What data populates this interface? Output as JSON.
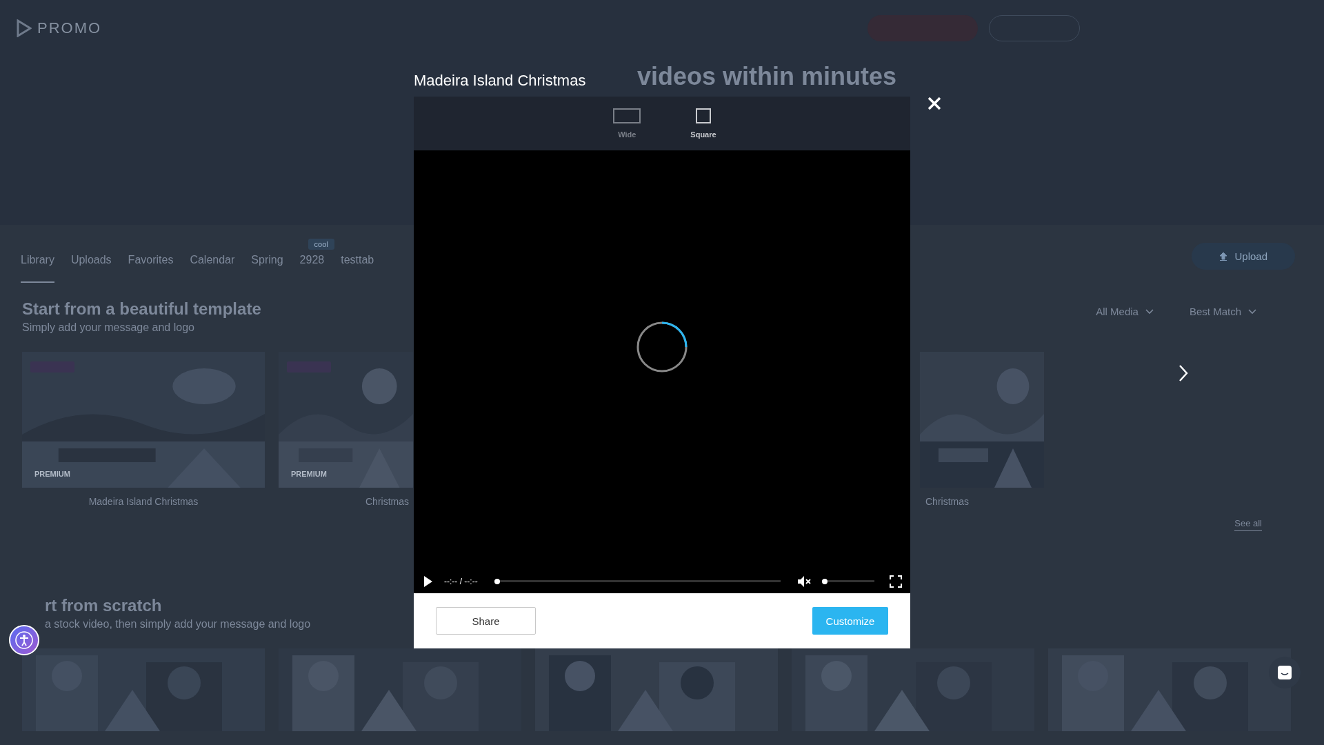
{
  "header": {
    "logo": "PROMO",
    "buttons": [
      {
        "kind": "filled"
      },
      {
        "kind": "outlined"
      }
    ],
    "headline": "videos within minutes"
  },
  "tabs": [
    {
      "label": "Library",
      "selected": true
    },
    {
      "label": "Uploads",
      "selected": false
    },
    {
      "label": "Favorites",
      "selected": false
    },
    {
      "label": "Calendar",
      "selected": false
    },
    {
      "label": "Spring",
      "selected": false
    },
    {
      "label": "2928",
      "selected": false,
      "badge": "cool"
    },
    {
      "label": "testtab",
      "selected": false
    }
  ],
  "upload_button": "Upload",
  "templates": {
    "title": "Start from a beautiful template",
    "subtitle": "Simply add your message and logo",
    "filters": [
      "All Media",
      "Best Match"
    ],
    "cards": [
      {
        "label": "Madeira Island Christmas",
        "premium": "PREMIUM"
      },
      {
        "label": "Christmas",
        "premium": "PREMIUM"
      },
      {
        "label": "Christmas"
      }
    ],
    "see_all": "See all"
  },
  "scratch": {
    "title": "rt from scratch",
    "subtitle": "a stock video, then simply add your message and logo"
  },
  "modal": {
    "title": "Madeira Island Christmas",
    "formats": [
      {
        "label": "Wide",
        "kind": "wide",
        "selected": false
      },
      {
        "label": "Square",
        "kind": "square",
        "selected": true
      }
    ],
    "loading": true,
    "player": {
      "time": "--:-- / --:--",
      "progress": {
        "level": 0
      },
      "muted": true,
      "volume": {
        "level": 0
      }
    },
    "buttons": [
      {
        "label": "Share",
        "kind": "secondary"
      },
      {
        "label": "Customize",
        "kind": "primary"
      }
    ]
  }
}
